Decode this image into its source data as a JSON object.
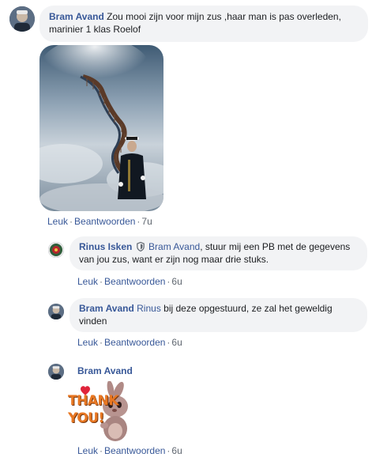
{
  "comments": [
    {
      "author": "Bram Avand",
      "text": "Zou mooi zijn voor mijn zus ,haar man is pas overleden, marinier 1 klas Roelof",
      "actions": {
        "like": "Leuk",
        "reply": "Beantwoorden",
        "time": "7u"
      }
    }
  ],
  "replies": [
    {
      "author": "Rinus Isken",
      "mention": "Bram Avand",
      "text": ", stuur mij een PB met de gegevens van jou zus, want er zijn nog maar drie stuks.",
      "actions": {
        "like": "Leuk",
        "reply": "Beantwoorden",
        "time": "6u"
      }
    },
    {
      "author": "Bram Avand",
      "mention": "Rinus",
      "text": " bij deze opgestuurd, ze zal het geweldig vinden",
      "actions": {
        "like": "Leuk",
        "reply": "Beantwoorden",
        "time": "6u"
      }
    },
    {
      "author": "Bram Avand",
      "sticker_text": "THANK YOU!",
      "actions": {
        "like": "Leuk",
        "reply": "Beantwoorden",
        "time": "6u"
      }
    }
  ],
  "separator": "·",
  "icons": {
    "verified": "shield-badge-icon"
  },
  "colors": {
    "link": "#385898",
    "bubble": "#f2f3f5",
    "meta": "#606770",
    "sticker_orange": "#e87722"
  }
}
